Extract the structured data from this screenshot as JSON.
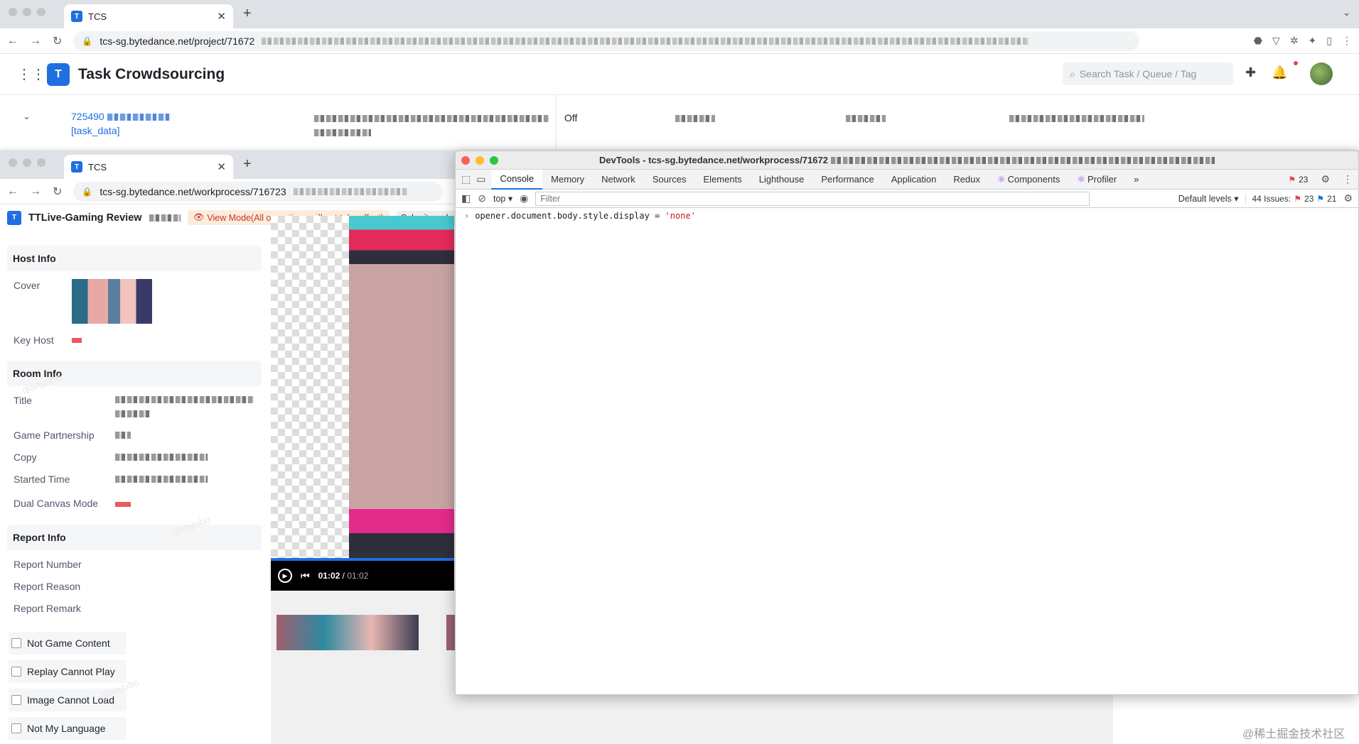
{
  "window1": {
    "tab_title": "TCS",
    "url": "tcs-sg.bytedance.net/project/71672",
    "app_title": "Task Crowdsourcing",
    "search_placeholder": "Search Task / Queue / Tag",
    "row": {
      "id": "725490",
      "link": "[task_data]",
      "status": "Off"
    }
  },
  "window2": {
    "tab_title": "TCS",
    "url": "tcs-sg.bytedance.net/workprocess/716723",
    "page_title": "TTLive-Gaming Review",
    "view_mode": "View Mode(All operations will not take effect)",
    "submit_mode": "Submit mode",
    "host_info": {
      "header": "Host Info",
      "cover_label": "Cover",
      "key_host_label": "Key Host"
    },
    "room_info": {
      "header": "Room Info",
      "title_label": "Title",
      "game_partnership_label": "Game Partnership",
      "copy_label": "Copy",
      "started_time_label": "Started Time",
      "dual_canvas_label": "Dual Canvas Mode"
    },
    "report_info": {
      "header": "Report Info",
      "number_label": "Report Number",
      "reason_label": "Report Reason",
      "remark_label": "Report Remark"
    },
    "checkboxes": [
      "Not Game Content",
      "Replay Cannot Play",
      "Image Cannot Load",
      "Not My Language"
    ],
    "video": {
      "current": "01:02",
      "separator": "/",
      "total": "01:02"
    }
  },
  "devtools": {
    "title": "DevTools - tcs-sg.bytedance.net/workprocess/71672",
    "tabs": [
      "Console",
      "Memory",
      "Network",
      "Sources",
      "Elements",
      "Lighthouse",
      "Performance",
      "Application",
      "Redux",
      "Components",
      "Profiler"
    ],
    "more": "»",
    "error_count": "23",
    "context": "top",
    "filter_placeholder": "Filter",
    "levels": "Default levels",
    "issues_label": "44 Issues:",
    "issues_errors": "23",
    "issues_info": "21",
    "console": {
      "code_prefix": "opener.document.body.style.display = ",
      "code_string": "'none'"
    }
  },
  "watermark": "qianyubo",
  "footer_mark": "@稀土掘金技术社区",
  "colors": {
    "accent": "#1a73e8",
    "brand": "#1f6fe0",
    "error": "#e5484d"
  }
}
